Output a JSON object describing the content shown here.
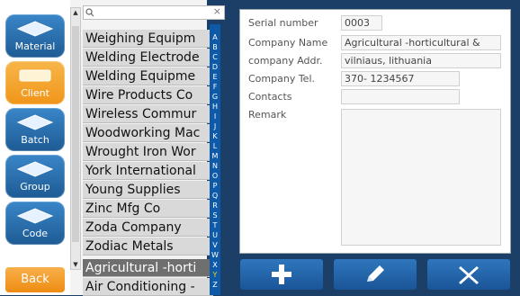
{
  "nav": {
    "items": [
      {
        "label": "Material"
      },
      {
        "label": "Client"
      },
      {
        "label": "Batch"
      },
      {
        "label": "Group"
      },
      {
        "label": "Code"
      }
    ],
    "active_index": 1,
    "back_label": "Back"
  },
  "search": {
    "value": "",
    "clear_label": "×"
  },
  "list": {
    "rows": [
      "Weighing Equipm",
      "Welding Electrode",
      "Welding Equipme",
      "Wire Products Co",
      "Wireless Commur",
      "Woodworking Mac",
      "Wrought Iron Wor",
      "York International",
      "Young Supplies",
      "Zinc Mfg Co",
      "Zoda Company",
      "Zodiac Metals",
      "Agricultural -horti",
      "Air Conditioning -"
    ],
    "selected_index": 12
  },
  "alphabet": [
    "A",
    "B",
    "C",
    "D",
    "E",
    "F",
    "G",
    "H",
    "I",
    "J",
    "K",
    "L",
    "M",
    "N",
    "O",
    "P",
    "Q",
    "R",
    "S",
    "T",
    "U",
    "V",
    "W",
    "X",
    "Y",
    "Z"
  ],
  "detail": {
    "serial_label": "Serial number",
    "serial_value": "0003",
    "name_label": "Company Name",
    "name_value": "Agricultural -horticultural &",
    "addr_label": "company Addr.",
    "addr_value": "vilniaus, lithuania",
    "tel_label": "Company Tel.",
    "tel_value": "370- 1234567",
    "contacts_label": "Contacts",
    "contacts_value": "",
    "remark_label": "Remark",
    "remark_value": ""
  },
  "actions": [
    {
      "name": "add",
      "icon": "plus-icon"
    },
    {
      "name": "edit",
      "icon": "pencil-icon"
    },
    {
      "name": "delete",
      "icon": "x-icon"
    }
  ],
  "colors": {
    "accent": "#1d5b94",
    "active": "#f0951a",
    "background": "#1b3f66"
  }
}
